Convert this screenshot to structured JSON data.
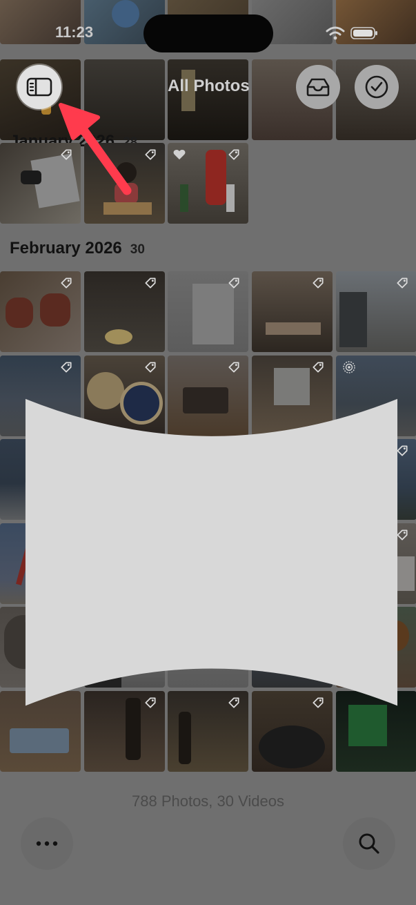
{
  "status": {
    "time": "11:23"
  },
  "header": {
    "title": "All Photos"
  },
  "sections": [
    {
      "title": "January 2026",
      "count": "28"
    },
    {
      "title": "February 2026",
      "count": "30"
    }
  ],
  "footer": {
    "stats": "788 Photos, 30 Videos"
  },
  "icons": {
    "sidebar": "sidebar-icon",
    "tray": "tray-icon",
    "select": "checkmark-circle-icon",
    "more": "ellipsis-icon",
    "search": "search-icon",
    "tag": "tag-icon",
    "heart": "heart-icon",
    "live": "live-photo-icon",
    "panorama": "panorama-icon",
    "wifi": "wifi-icon",
    "battery": "battery-icon",
    "arrow": "annotation-arrow"
  },
  "colors": {
    "arrow": "#ff3b4d"
  }
}
